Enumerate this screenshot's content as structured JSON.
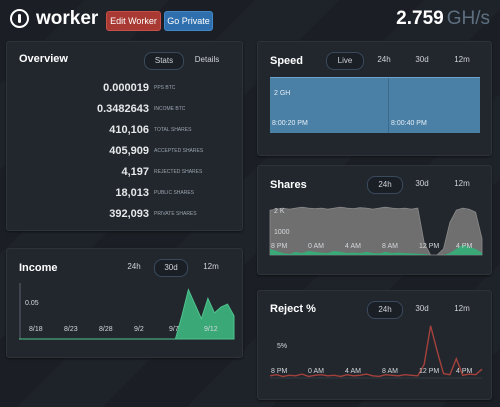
{
  "header": {
    "title": "worker",
    "edit_label": "Edit Worker",
    "private_label": "Go Private",
    "hashrate": "2.759",
    "hashrate_unit": "GH/s"
  },
  "overview": {
    "title": "Overview",
    "tabs": [
      "Stats",
      "Details"
    ],
    "stats": [
      {
        "value": "0.000019",
        "label": "PPS BTC"
      },
      {
        "value": "0.3482643",
        "label": "INCOME BTC"
      },
      {
        "value": "410,106",
        "label": "TOTAL SHARES"
      },
      {
        "value": "405,909",
        "label": "ACCEPTED SHARES"
      },
      {
        "value": "4,197",
        "label": "REJECTED SHARES"
      },
      {
        "value": "18,013",
        "label": "PUBLIC SHARES"
      },
      {
        "value": "392,093",
        "label": "PRIVATE SHARES"
      }
    ]
  },
  "income": {
    "title": "Income",
    "tabs": [
      "24h",
      "30d",
      "12m"
    ],
    "chart": {
      "ytick": "0.05",
      "xticks": [
        "8/18",
        "8/23",
        "8/28",
        "9/2",
        "9/7",
        "9/12"
      ]
    }
  },
  "speed": {
    "title": "Speed",
    "tabs": [
      "Live",
      "24h",
      "30d",
      "12m"
    ],
    "chart": {
      "ytick": "2 GH",
      "xticks": [
        "8:00:20 PM",
        "8:00:40 PM"
      ]
    }
  },
  "shares": {
    "title": "Shares",
    "tabs": [
      "24h",
      "30d",
      "12m"
    ],
    "chart": {
      "yticks": [
        "2 K",
        "1000"
      ],
      "xticks": [
        "8 PM",
        "0 AM",
        "4 AM",
        "8 AM",
        "12 PM",
        "4 PM"
      ]
    }
  },
  "reject": {
    "title": "Reject %",
    "tabs": [
      "24h",
      "30d",
      "12m"
    ],
    "chart": {
      "ytick": "5%",
      "xticks": [
        "8 PM",
        "0 AM",
        "4 AM",
        "8 AM",
        "12 PM",
        "4 PM"
      ]
    }
  },
  "chart_data": [
    {
      "type": "area",
      "ylabel": "",
      "categories": [
        "8/18",
        "8/23",
        "8/28",
        "9/2",
        "9/7",
        "9/12"
      ],
      "series": [
        {
          "values": [
            0,
            0,
            0,
            0,
            0,
            0,
            0,
            0,
            0,
            0,
            0,
            0,
            0,
            0,
            0,
            0,
            0,
            0,
            0,
            0,
            0,
            0,
            0,
            0,
            0,
            0.04,
            0.085,
            0.06,
            0.035,
            0.07,
            0.045,
            0.055,
            0.06,
            0.04
          ]
        }
      ],
      "ylim": [
        0,
        0.1
      ]
    },
    {
      "type": "area",
      "categories": [
        "8 PM",
        "0 AM",
        "4 AM",
        "8 AM",
        "12 PM",
        "4 PM"
      ],
      "series": [
        {
          "values": [
            2200,
            2250,
            2300,
            2250,
            2300,
            2350,
            2300,
            2280,
            2300,
            2250,
            2300,
            2350,
            2300,
            2280,
            2320,
            2300,
            2250,
            2300,
            2350,
            2300,
            2280,
            2300,
            2250,
            2300,
            600,
            0,
            0,
            300,
            1600,
            2200,
            2300,
            2250,
            2100,
            800
          ]
        },
        {
          "values": [
            300,
            200,
            100,
            50,
            150,
            100,
            200,
            150,
            120,
            100,
            200,
            150,
            100,
            120,
            100,
            150,
            100,
            80,
            150,
            100,
            120,
            100,
            80,
            60,
            50,
            0,
            0,
            0,
            100,
            300,
            500,
            400,
            300,
            100
          ]
        }
      ],
      "ylim": [
        0,
        2700
      ]
    },
    {
      "type": "line",
      "categories": [
        "8 PM",
        "0 AM",
        "4 AM",
        "8 AM",
        "12 PM",
        "4 PM"
      ],
      "series": [
        {
          "values": [
            0.4,
            0.6,
            0.3,
            0.5,
            0.4,
            0.7,
            0.3,
            0.5,
            0.6,
            0.4,
            0.5,
            0.3,
            0.6,
            0.4,
            0.5,
            0.7,
            0.4,
            0.3,
            0.6,
            0.5,
            0.4,
            0.6,
            0.5,
            0.4,
            2.5,
            9.5,
            5.0,
            0.8,
            0.6,
            3.5,
            0.5,
            0.7,
            0.6,
            1.6
          ]
        }
      ],
      "ylim": [
        0,
        10
      ]
    }
  ]
}
